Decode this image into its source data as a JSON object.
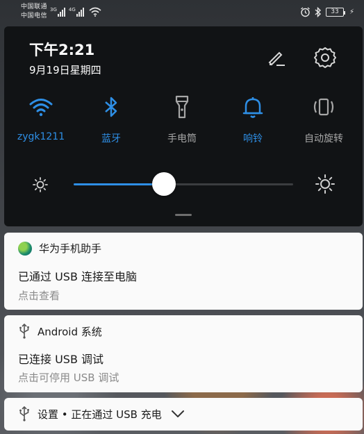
{
  "status_bar": {
    "carrier_1": "中国联通",
    "carrier_2": "中国电信",
    "network_1": "3G",
    "network_2": "4G",
    "battery_level": "33"
  },
  "quick_settings": {
    "time": "下午2:21",
    "date": "9月19日星期四",
    "tiles": [
      {
        "label": "zygk1211",
        "icon": "wifi-icon",
        "active": true
      },
      {
        "label": "蓝牙",
        "icon": "bluetooth-icon",
        "active": true
      },
      {
        "label": "手电筒",
        "icon": "flashlight-icon",
        "active": false
      },
      {
        "label": "响铃",
        "icon": "bell-icon",
        "active": true
      },
      {
        "label": "自动旋转",
        "icon": "auto-rotate-icon",
        "active": false
      }
    ],
    "brightness_fraction": 0.41
  },
  "notifications": [
    {
      "app": "华为手机助手",
      "app_icon": "huawei-assistant-icon",
      "title": "已通过 USB 连接至电脑",
      "subtitle": "点击查看"
    },
    {
      "app": "Android 系统",
      "app_icon": "usb-icon",
      "title": "已连接 USB 调试",
      "subtitle": "点击可停用 USB 调试"
    },
    {
      "app": "设置 • 正在通过 USB 充电",
      "app_icon": "usb-icon"
    }
  ],
  "colors": {
    "accent": "#2e8fe6",
    "panel_bg": "#111315",
    "card_bg": "#fafafa",
    "inactive_label": "#a7a7a7"
  }
}
